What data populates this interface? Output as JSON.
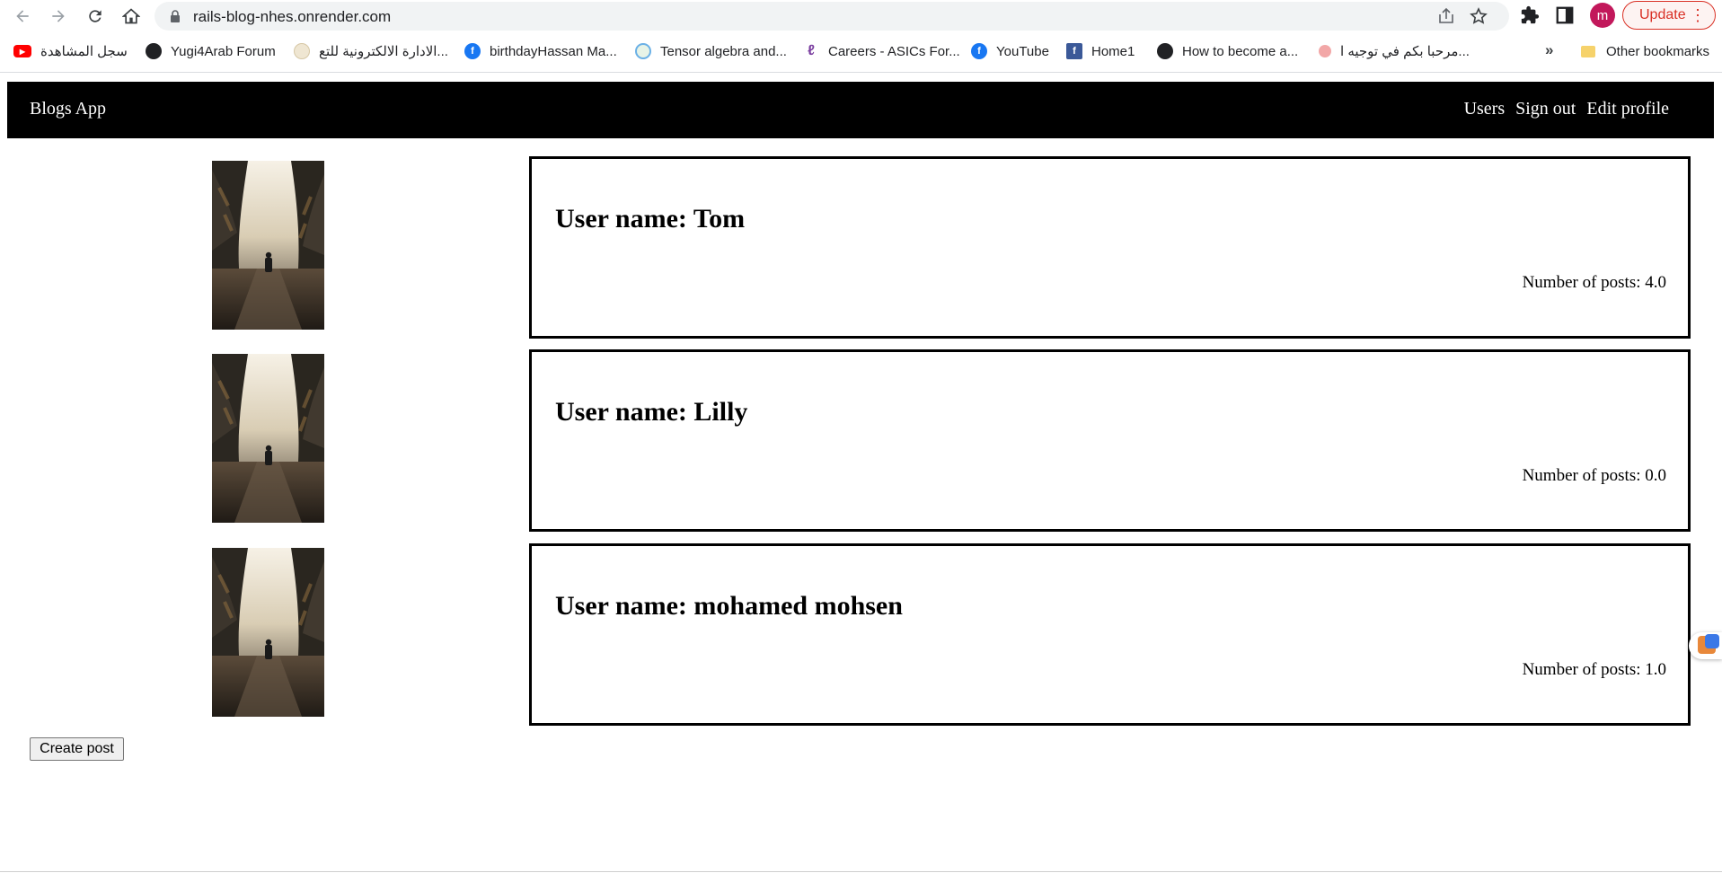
{
  "browser": {
    "url": "rails-blog-nhes.onrender.com",
    "profile_initial": "m",
    "update_label": "Update",
    "bookmarks": [
      {
        "label": "سجل المشاهدة",
        "icon": "youtube-icon"
      },
      {
        "label": "Yugi4Arab Forum",
        "icon": "globe-icon"
      },
      {
        "label": "الادارة الالكترونية للتع...",
        "icon": "site-icon"
      },
      {
        "label": "birthdayHassan Ma...",
        "icon": "facebook-icon"
      },
      {
        "label": "Tensor algebra and...",
        "icon": "site-icon"
      },
      {
        "label": "Careers - ASICs For...",
        "icon": "site-icon"
      },
      {
        "label": "YouTube",
        "icon": "facebook-icon"
      },
      {
        "label": "Home1",
        "icon": "facebook-square-icon"
      },
      {
        "label": "How to become a...",
        "icon": "globe-icon"
      },
      {
        "label": "مرحبا بكم في توجيه ا...",
        "icon": "site-icon"
      }
    ],
    "more_bookmarks": "»",
    "other_bookmarks": "Other bookmarks"
  },
  "navbar": {
    "brand": "Blogs App",
    "links": [
      "Users",
      "Sign out",
      "Edit profile"
    ]
  },
  "users": [
    {
      "name": "User name: Tom",
      "posts": "Number of posts: 4.0"
    },
    {
      "name": "User name: Lilly",
      "posts": "Number of posts: 0.0"
    },
    {
      "name": "User name: mohamed mohsen",
      "posts": "Number of posts: 1.0"
    }
  ],
  "create_post_label": "Create post",
  "colors": {
    "navbar_bg": "#000000",
    "update_accent": "#d93025",
    "avatar_bg": "#c2185b"
  }
}
